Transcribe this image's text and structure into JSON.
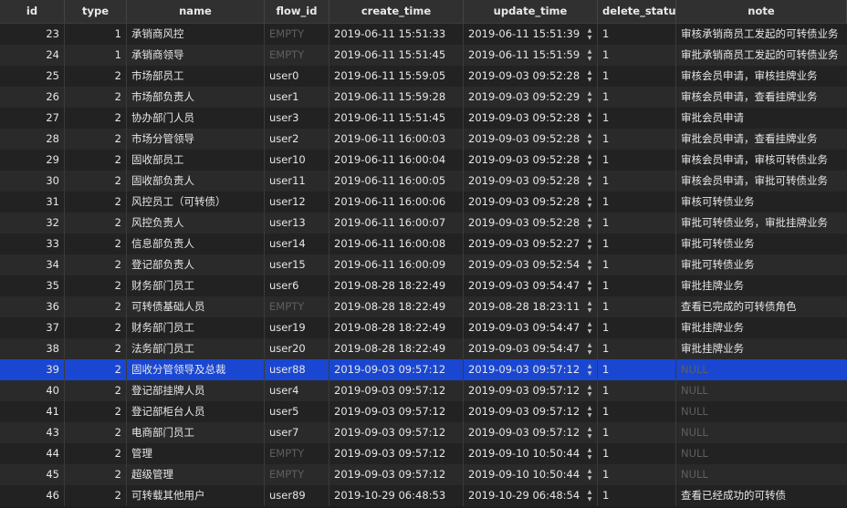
{
  "columns": {
    "id": "id",
    "type": "type",
    "name": "name",
    "flow_id": "flow_id",
    "create_time": "create_time",
    "update_time": "update_time",
    "delete_status": "delete_status",
    "note": "note"
  },
  "selected_index": 16,
  "stepper": {
    "up": "▲",
    "down": "▼"
  },
  "rows": [
    {
      "id": "23",
      "type": "1",
      "name": "承销商风控",
      "flow_id": "EMPTY",
      "create_time": "2019-06-11 15:51:33",
      "update_time": "2019-06-11 15:51:39",
      "delete_status": "1",
      "note": "审核承销商员工发起的可转债业务"
    },
    {
      "id": "24",
      "type": "1",
      "name": "承销商领导",
      "flow_id": "EMPTY",
      "create_time": "2019-06-11 15:51:45",
      "update_time": "2019-06-11 15:51:59",
      "delete_status": "1",
      "note": "审批承销商员工发起的可转债业务"
    },
    {
      "id": "25",
      "type": "2",
      "name": "市场部员工",
      "flow_id": "user0",
      "create_time": "2019-06-11 15:59:05",
      "update_time": "2019-09-03 09:52:28",
      "delete_status": "1",
      "note": "审核会员申请，审核挂牌业务"
    },
    {
      "id": "26",
      "type": "2",
      "name": "市场部负责人",
      "flow_id": "user1",
      "create_time": "2019-06-11 15:59:28",
      "update_time": "2019-09-03 09:52:29",
      "delete_status": "1",
      "note": "审核会员申请，查看挂牌业务"
    },
    {
      "id": "27",
      "type": "2",
      "name": "协办部门人员",
      "flow_id": "user3",
      "create_time": "2019-06-11 15:51:45",
      "update_time": "2019-09-03 09:52:28",
      "delete_status": "1",
      "note": "审批会员申请"
    },
    {
      "id": "28",
      "type": "2",
      "name": "市场分管领导",
      "flow_id": "user2",
      "create_time": "2019-06-11 16:00:03",
      "update_time": "2019-09-03 09:52:28",
      "delete_status": "1",
      "note": "审批会员申请，查看挂牌业务"
    },
    {
      "id": "29",
      "type": "2",
      "name": "固收部员工",
      "flow_id": "user10",
      "create_time": "2019-06-11 16:00:04",
      "update_time": "2019-09-03 09:52:28",
      "delete_status": "1",
      "note": "审核会员申请，审核可转债业务"
    },
    {
      "id": "30",
      "type": "2",
      "name": "固收部负责人",
      "flow_id": "user11",
      "create_time": "2019-06-11 16:00:05",
      "update_time": "2019-09-03 09:52:28",
      "delete_status": "1",
      "note": "审核会员申请，审批可转债业务"
    },
    {
      "id": "31",
      "type": "2",
      "name": "风控员工（可转债）",
      "flow_id": "user12",
      "create_time": "2019-06-11 16:00:06",
      "update_time": "2019-09-03 09:52:28",
      "delete_status": "1",
      "note": "审核可转债业务"
    },
    {
      "id": "32",
      "type": "2",
      "name": "风控负责人",
      "flow_id": "user13",
      "create_time": "2019-06-11 16:00:07",
      "update_time": "2019-09-03 09:52:28",
      "delete_status": "1",
      "note": "审批可转债业务，审批挂牌业务"
    },
    {
      "id": "33",
      "type": "2",
      "name": "信息部负责人",
      "flow_id": "user14",
      "create_time": "2019-06-11 16:00:08",
      "update_time": "2019-09-03 09:52:27",
      "delete_status": "1",
      "note": "审批可转债业务"
    },
    {
      "id": "34",
      "type": "2",
      "name": "登记部负责人",
      "flow_id": "user15",
      "create_time": "2019-06-11 16:00:09",
      "update_time": "2019-09-03 09:52:54",
      "delete_status": "1",
      "note": "审批可转债业务"
    },
    {
      "id": "35",
      "type": "2",
      "name": "财务部门员工",
      "flow_id": "user6",
      "create_time": "2019-08-28 18:22:49",
      "update_time": "2019-09-03 09:54:47",
      "delete_status": "1",
      "note": "审批挂牌业务"
    },
    {
      "id": "36",
      "type": "2",
      "name": "可转债基础人员",
      "flow_id": "EMPTY",
      "create_time": "2019-08-28 18:22:49",
      "update_time": "2019-08-28 18:23:11",
      "delete_status": "1",
      "note": "查看已完成的可转债角色"
    },
    {
      "id": "37",
      "type": "2",
      "name": "财务部门员工",
      "flow_id": "user19",
      "create_time": "2019-08-28 18:22:49",
      "update_time": "2019-09-03 09:54:47",
      "delete_status": "1",
      "note": "审批挂牌业务"
    },
    {
      "id": "38",
      "type": "2",
      "name": "法务部门员工",
      "flow_id": "user20",
      "create_time": "2019-08-28 18:22:49",
      "update_time": "2019-09-03 09:54:47",
      "delete_status": "1",
      "note": "审批挂牌业务"
    },
    {
      "id": "39",
      "type": "2",
      "name": "固收分管领导及总裁",
      "flow_id": "user88",
      "create_time": "2019-09-03 09:57:12",
      "update_time": "2019-09-03 09:57:12",
      "delete_status": "1",
      "note": "NULL"
    },
    {
      "id": "40",
      "type": "2",
      "name": "登记部挂牌人员",
      "flow_id": "user4",
      "create_time": "2019-09-03 09:57:12",
      "update_time": "2019-09-03 09:57:12",
      "delete_status": "1",
      "note": "NULL"
    },
    {
      "id": "41",
      "type": "2",
      "name": "登记部柜台人员",
      "flow_id": "user5",
      "create_time": "2019-09-03 09:57:12",
      "update_time": "2019-09-03 09:57:12",
      "delete_status": "1",
      "note": "NULL"
    },
    {
      "id": "43",
      "type": "2",
      "name": "电商部门员工",
      "flow_id": "user7",
      "create_time": "2019-09-03 09:57:12",
      "update_time": "2019-09-03 09:57:12",
      "delete_status": "1",
      "note": "NULL"
    },
    {
      "id": "44",
      "type": "2",
      "name": "管理",
      "flow_id": "EMPTY",
      "create_time": "2019-09-03 09:57:12",
      "update_time": "2019-09-10 10:50:44",
      "delete_status": "1",
      "note": "NULL"
    },
    {
      "id": "45",
      "type": "2",
      "name": "超级管理",
      "flow_id": "EMPTY",
      "create_time": "2019-09-03 09:57:12",
      "update_time": "2019-09-10 10:50:44",
      "delete_status": "1",
      "note": "NULL"
    },
    {
      "id": "46",
      "type": "2",
      "name": "可转载其他用户",
      "flow_id": "user89",
      "create_time": "2019-10-29 06:48:53",
      "update_time": "2019-10-29 06:48:54",
      "delete_status": "1",
      "note": "查看已经成功的可转债"
    }
  ]
}
